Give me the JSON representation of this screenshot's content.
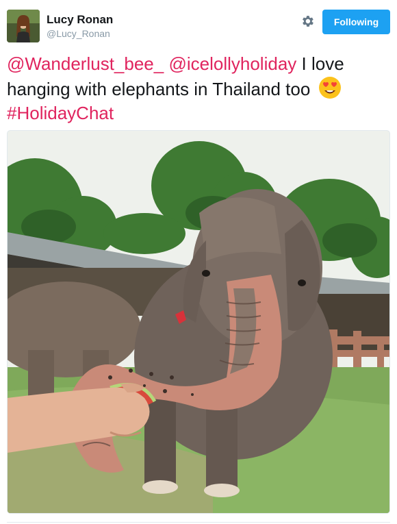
{
  "user": {
    "display_name": "Lucy Ronan",
    "handle": "@Lucy_Ronan"
  },
  "header": {
    "follow_label": "Following",
    "accent_color": "#1da1f2"
  },
  "tweet": {
    "mention_1": "@Wanderlust_bee_",
    "mention_2": "@icelollyholiday",
    "text": " I love hanging with elephants in Thailand too ",
    "emoji": "heart-eyes-emoji",
    "hashtag": "#HolidayChat",
    "link_color": "#e0245e"
  },
  "media": {
    "subject": "elephant-photo"
  }
}
